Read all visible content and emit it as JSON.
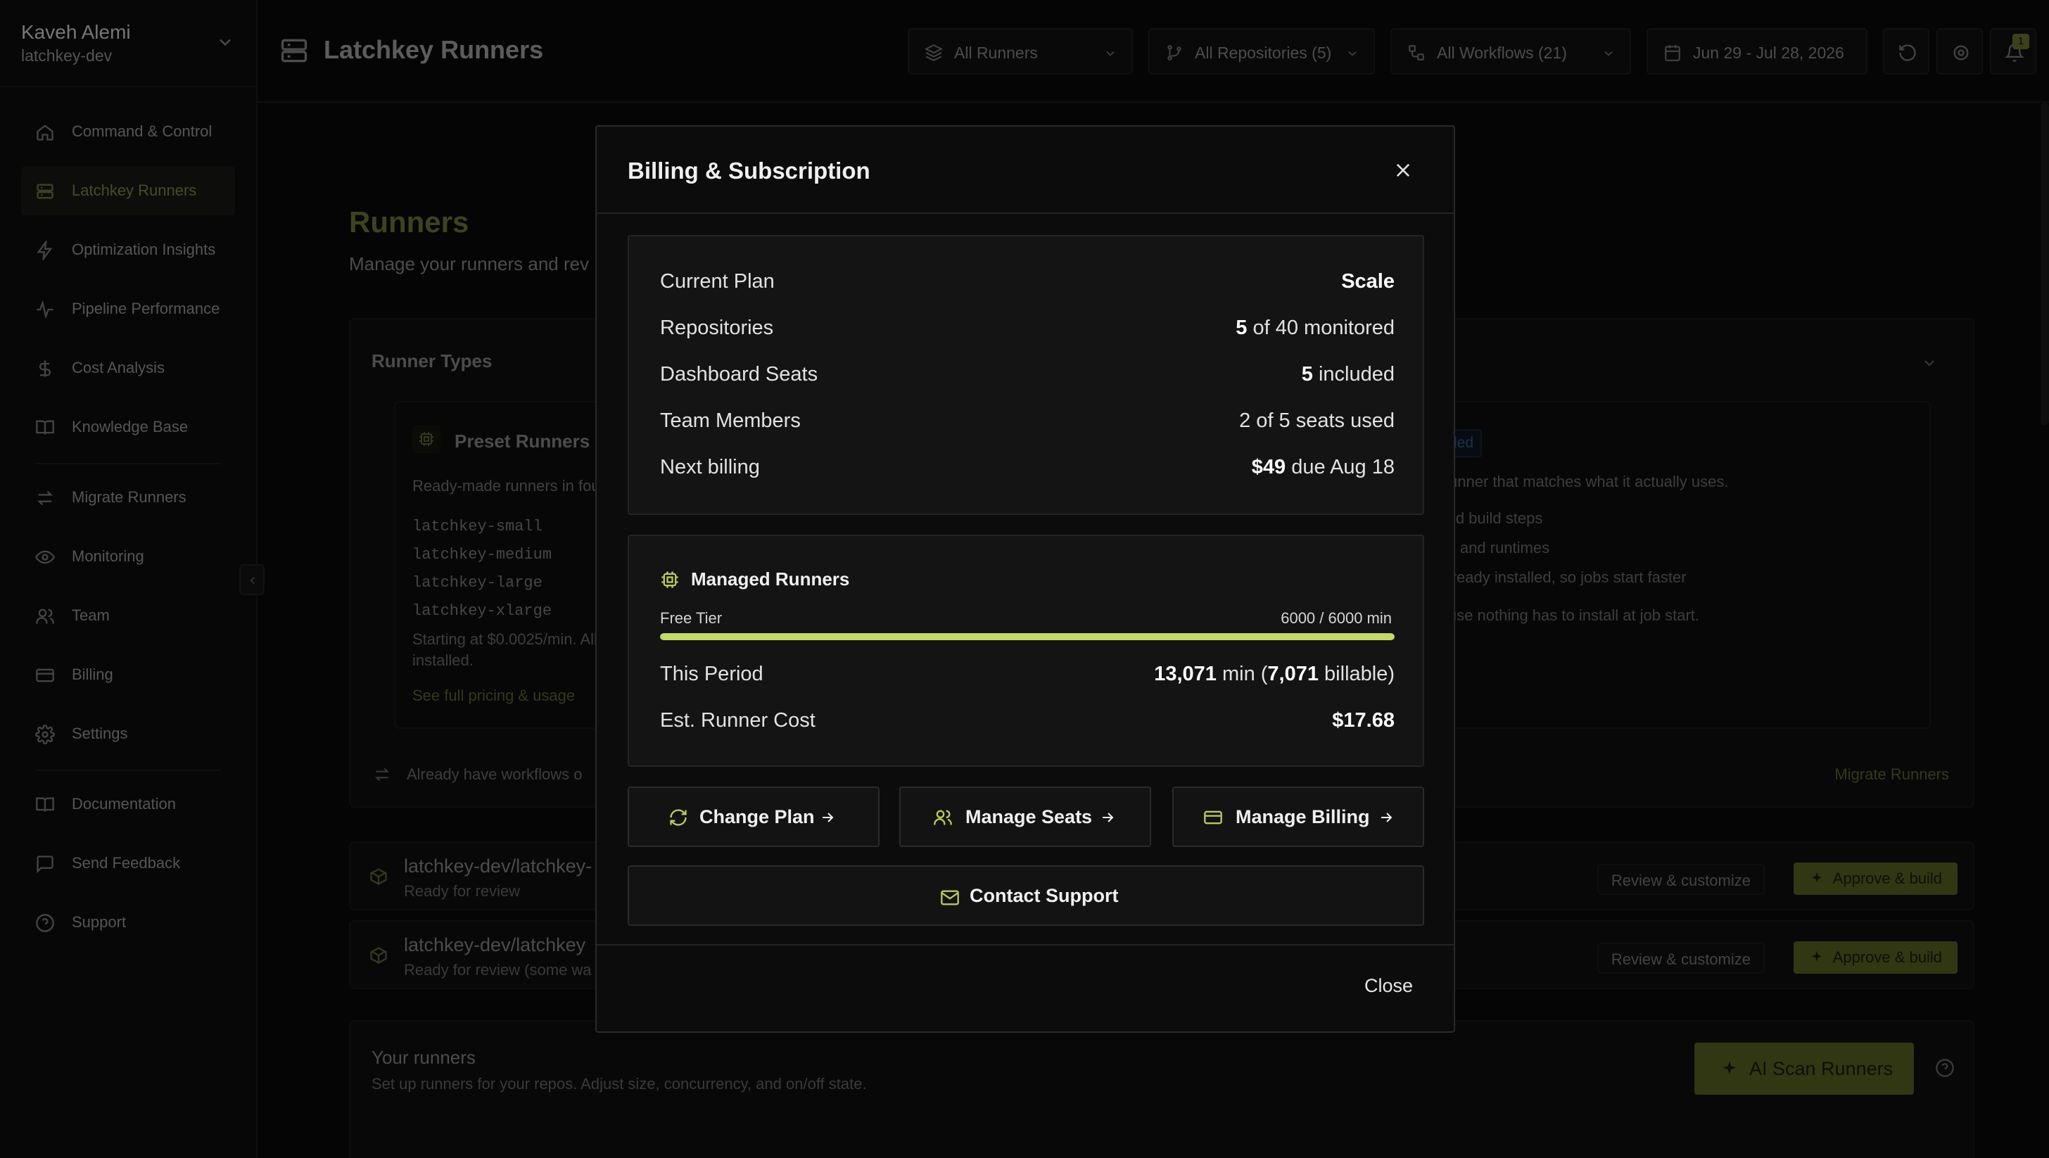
{
  "user": {
    "name": "Kaveh Alemi",
    "org": "latchkey-dev"
  },
  "sidebar": {
    "items": [
      {
        "label": "Command & Control",
        "icon": "home-icon"
      },
      {
        "label": "Latchkey Runners",
        "icon": "server-icon",
        "active": true
      },
      {
        "label": "Optimization Insights",
        "icon": "bolt-icon"
      },
      {
        "label": "Pipeline Performance",
        "icon": "activity-icon"
      },
      {
        "label": "Cost Analysis",
        "icon": "dollar-icon"
      },
      {
        "label": "Knowledge Base",
        "icon": "book-icon"
      },
      {
        "label": "Migrate Runners",
        "icon": "swap-icon"
      },
      {
        "label": "Monitoring",
        "icon": "eye-icon"
      },
      {
        "label": "Team",
        "icon": "users-icon"
      },
      {
        "label": "Billing",
        "icon": "card-icon"
      },
      {
        "label": "Settings",
        "icon": "gear-icon"
      },
      {
        "label": "Documentation",
        "icon": "book-icon"
      },
      {
        "label": "Send Feedback",
        "icon": "message-icon"
      },
      {
        "label": "Support",
        "icon": "help-icon"
      }
    ]
  },
  "header": {
    "title": "Latchkey Runners",
    "filters": {
      "runners": "All Runners",
      "repositories": "All Repositories (5)",
      "workflows": "All Workflows (21)",
      "date_range": "Jun 29 - Jul 28, 2026"
    },
    "notification_count": "1"
  },
  "main": {
    "title": "Runners",
    "subtitle": "Manage your runners and rev",
    "runner_types": {
      "title": "Runner Types",
      "preset": {
        "title": "Preset Runners",
        "desc": "Ready-made runners in four",
        "sizes": [
          "latchkey-small",
          "latchkey-medium",
          "latchkey-large",
          "latchkey-xlarge"
        ],
        "footer": "Starting at $0.0025/min. All installed.",
        "link": "See full pricing & usage"
      },
      "recommended": {
        "badge": "mended",
        "lines": [
          "ds a runner that matches what it actually uses.",
          "ies, and build steps",
          "kages, and runtimes",
          "ges already installed, so jobs start faster",
          ", because nothing has to install at job start."
        ]
      },
      "migrate_text": "Already have workflows o",
      "migrate_link": "Migrate Runners"
    },
    "repos": [
      {
        "name": "latchkey-dev/latchkey-",
        "status": "Ready for review"
      },
      {
        "name": "latchkey-dev/latchkey",
        "status": "Ready for review (some wa"
      }
    ],
    "review_label": "Review & customize",
    "approve_label": "Approve & build",
    "your_runners": {
      "title": "Your runners",
      "subtitle": "Set up runners for your repos. Adjust size, concurrency, and on/off state.",
      "ai_scan": "AI Scan Runners"
    }
  },
  "modal": {
    "title": "Billing & Subscription",
    "info": {
      "plan_label": "Current Plan",
      "plan_value": "Scale",
      "repos_label": "Repositories",
      "repos_strong": "5",
      "repos_rest": " of 40 monitored",
      "seats_label": "Dashboard Seats",
      "seats_strong": "5",
      "seats_rest": " included",
      "team_label": "Team Members",
      "team_value": "2 of 5 seats used",
      "billing_label": "Next billing",
      "billing_strong": "$49",
      "billing_rest": " due Aug 18"
    },
    "runners": {
      "title": "Managed Runners",
      "tier_label": "Free Tier",
      "tier_count": "6000 / 6000 min",
      "usage_fraction": 1.0,
      "period_label": "This Period",
      "period_minutes": "13,071",
      "period_min_word": " min (",
      "period_billable": "7,071",
      "period_billable_word": " billable)",
      "cost_label": "Est. Runner Cost",
      "cost_value": "$17.68"
    },
    "actions": {
      "change_plan": "Change Plan",
      "manage_seats": "Manage Seats",
      "manage_billing": "Manage Billing",
      "contact_support": "Contact Support",
      "close": "Close"
    },
    "accent_color": "#c3d96a"
  }
}
